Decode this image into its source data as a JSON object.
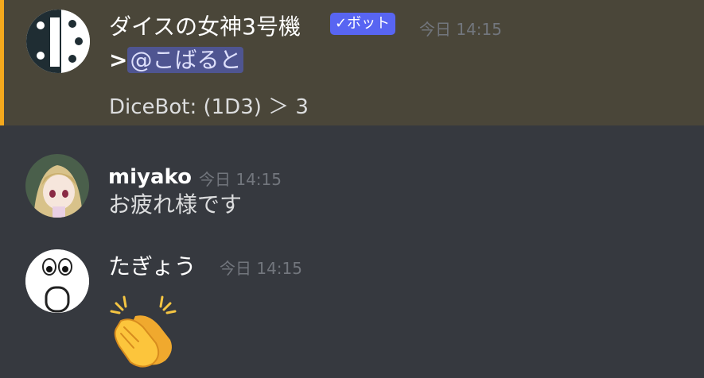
{
  "messages": [
    {
      "username": "ダイスの女神3号機",
      "bot_tag": "✓ボット",
      "timestamp": "今日 14:15",
      "reply_prefix": ">",
      "mention": "@こばると",
      "dice_result": "DiceBot: (1D3) ＞ 3",
      "highlight_color": "#f4a91d"
    },
    {
      "username": "miyako",
      "timestamp": "今日 14:15",
      "text": "お疲れ様です"
    },
    {
      "username": "たぎょう",
      "timestamp": "今日 14:15",
      "emoji": "clapping-hands"
    }
  ],
  "colors": {
    "background": "#36393f",
    "highlight_background": "#4a4639",
    "bot_tag": "#5865f2",
    "mention_background": "#4f5591",
    "timestamp": "#72767d"
  }
}
